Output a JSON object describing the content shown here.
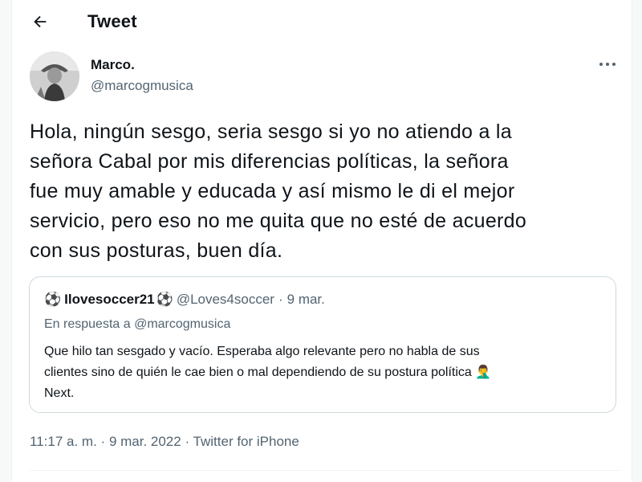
{
  "header": {
    "title": "Tweet",
    "back_icon": "arrow-left-icon"
  },
  "author": {
    "name": "Marco.",
    "handle": "@marcogmusica",
    "avatar_icon": "profile-photo"
  },
  "tweet": {
    "lines": [
      "Hola, ningún sesgo, seria sesgo si yo no atiendo a la",
      "señora Cabal por mis diferencias políticas, la señora",
      "fue muy amable y educada y así mismo le di el mejor",
      "servicio, pero eso no me quita que no esté de acuerdo",
      "con sus posturas, buen día."
    ]
  },
  "quoted": {
    "name": "Ilovesoccer21",
    "ball_emoji": "⚽",
    "handle": "@Loves4soccer",
    "separator": "·",
    "date": "9 mar.",
    "reply_prefix": "En respuesta a",
    "reply_to": "@marcogmusica",
    "lines": [
      "Que hilo tan sesgado y vacío. Esperaba algo relevante pero no habla de sus",
      "clientes sino de quién le cae bien o mal dependiendo de su postura política 🤦‍♂️",
      "Next."
    ]
  },
  "meta": {
    "time": "11:17 a. m.",
    "date": "9 mar. 2022",
    "source": "Twitter for iPhone",
    "separator": "·"
  },
  "colors": {
    "text": "#0f1419",
    "secondary": "#536471",
    "border": "#cfd9de"
  }
}
